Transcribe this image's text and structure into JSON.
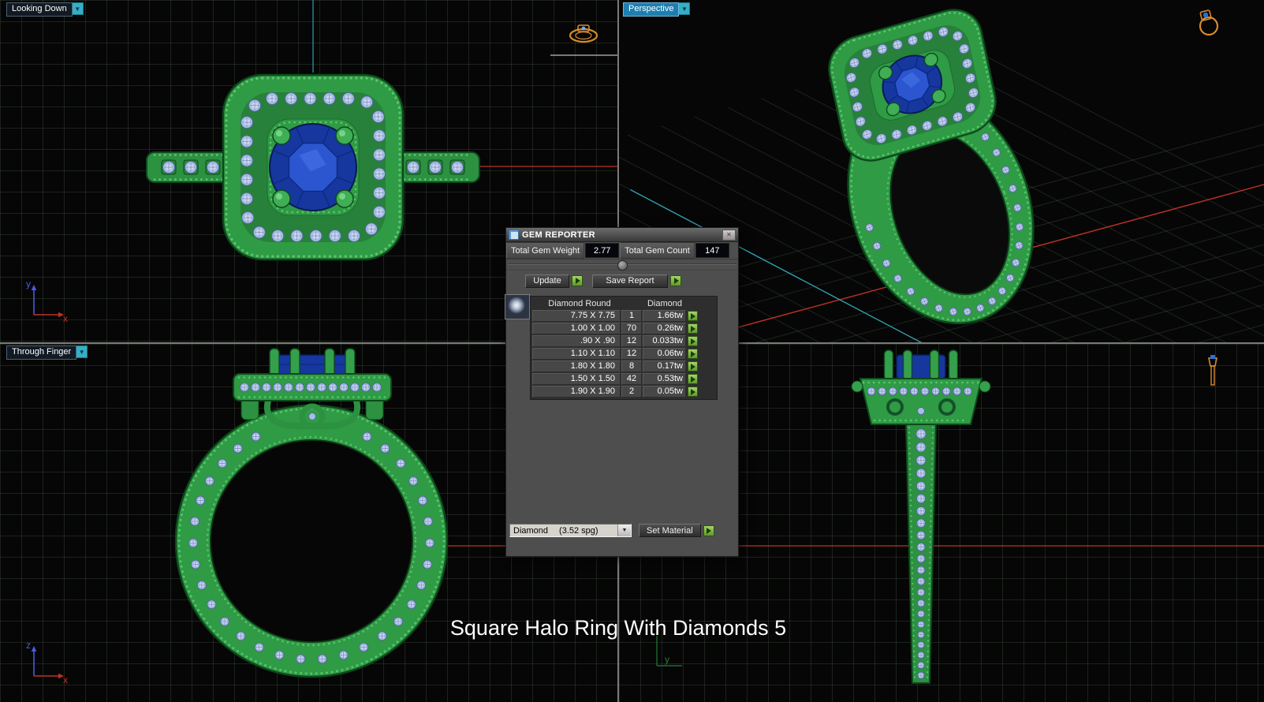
{
  "caption": "Square Halo Ring With Diamonds 5",
  "viewports": {
    "top_left": {
      "label": "Looking Down",
      "menu_arrow": "▼",
      "axis": {
        "vertical": "y",
        "horizontal": "x"
      }
    },
    "top_right": {
      "label": "Perspective",
      "menu_arrow": "▼"
    },
    "bottom_left": {
      "label": "Through Finger",
      "menu_arrow": "▼",
      "axis": {
        "vertical": "z",
        "horizontal": "x"
      }
    },
    "bottom_right": {
      "axis": {
        "vertical": "y"
      }
    }
  },
  "gem_reporter": {
    "title": "GEM REPORTER",
    "close_glyph": "✕",
    "stats": {
      "weight_label": "Total Gem Weight",
      "weight_value": "2.77",
      "count_label": "Total Gem Count",
      "count_value": "147"
    },
    "buttons": {
      "update": "Update",
      "save_report": "Save Report",
      "set_material": "Set Material"
    },
    "table": {
      "col1_header": "Diamond Round",
      "col2_header": "Diamond",
      "rows": [
        {
          "size": "7.75 X 7.75",
          "count": "1",
          "weight": "1.66tw"
        },
        {
          "size": "1.00 X 1.00",
          "count": "70",
          "weight": "0.26tw"
        },
        {
          "size": ".90 X .90",
          "count": "12",
          "weight": "0.033tw"
        },
        {
          "size": "1.10 X 1.10",
          "count": "12",
          "weight": "0.06tw"
        },
        {
          "size": "1.80 X 1.80",
          "count": "8",
          "weight": "0.17tw"
        },
        {
          "size": "1.50 X 1.50",
          "count": "42",
          "weight": "0.53tw"
        },
        {
          "size": "1.90 X 1.90",
          "count": "2",
          "weight": "0.05tw"
        }
      ]
    },
    "material": {
      "name": "Diamond",
      "detail": "(3.52 spg)",
      "arrow": "▼"
    }
  },
  "colors": {
    "ring_green": "#2f9b45",
    "center_gem_blue": "#16379e",
    "small_gem_blue": "#a7bde4",
    "accent_teal": "#35aec6",
    "axis_red": "#c03028",
    "axis_cyan": "#2f9fae",
    "go_button_green": "#6aa83a"
  }
}
